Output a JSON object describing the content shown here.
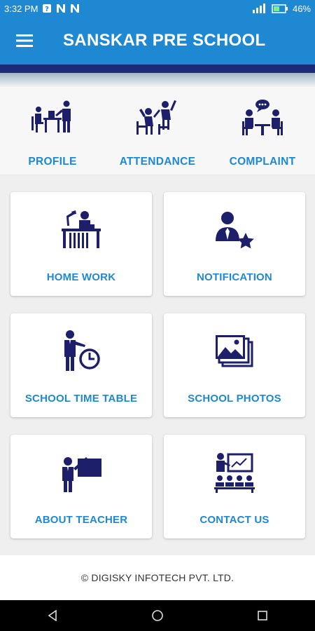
{
  "status_bar": {
    "time": "3:32 PM",
    "battery": "46%",
    "notification_icons": [
      "sim-icon",
      "n-icon",
      "n-icon"
    ],
    "right_icons": [
      "signal-icon",
      "battery-icon"
    ]
  },
  "app_bar": {
    "title": "SANSKAR PRE SCHOOL",
    "menu_icon": "hamburger-icon"
  },
  "quick_actions": [
    {
      "label": "PROFILE",
      "icon": "profile-desk-icon"
    },
    {
      "label": "ATTENDANCE",
      "icon": "attendance-raise-hand-icon"
    },
    {
      "label": "COMPLAINT",
      "icon": "complaint-discussion-icon"
    }
  ],
  "cards": [
    {
      "label": "HOME WORK",
      "icon": "homework-desk-icon"
    },
    {
      "label": "NOTIFICATION",
      "icon": "user-star-icon"
    },
    {
      "label": "SCHOOL TIME TABLE",
      "icon": "teacher-clock-icon"
    },
    {
      "label": "SCHOOL PHOTOS",
      "icon": "photo-gallery-icon"
    },
    {
      "label": "ABOUT TEACHER",
      "icon": "teacher-board-icon"
    },
    {
      "label": "CONTACT US",
      "icon": "classroom-presentation-icon"
    }
  ],
  "footer": {
    "text": "© DIGISKY INFOTECH PVT. LTD."
  },
  "nav_bar": {
    "buttons": [
      "back-icon",
      "home-icon",
      "recents-icon"
    ]
  },
  "colors": {
    "primary": "#1e88d2",
    "icon_navy": "#1d1f6b",
    "background": "#efefef"
  }
}
